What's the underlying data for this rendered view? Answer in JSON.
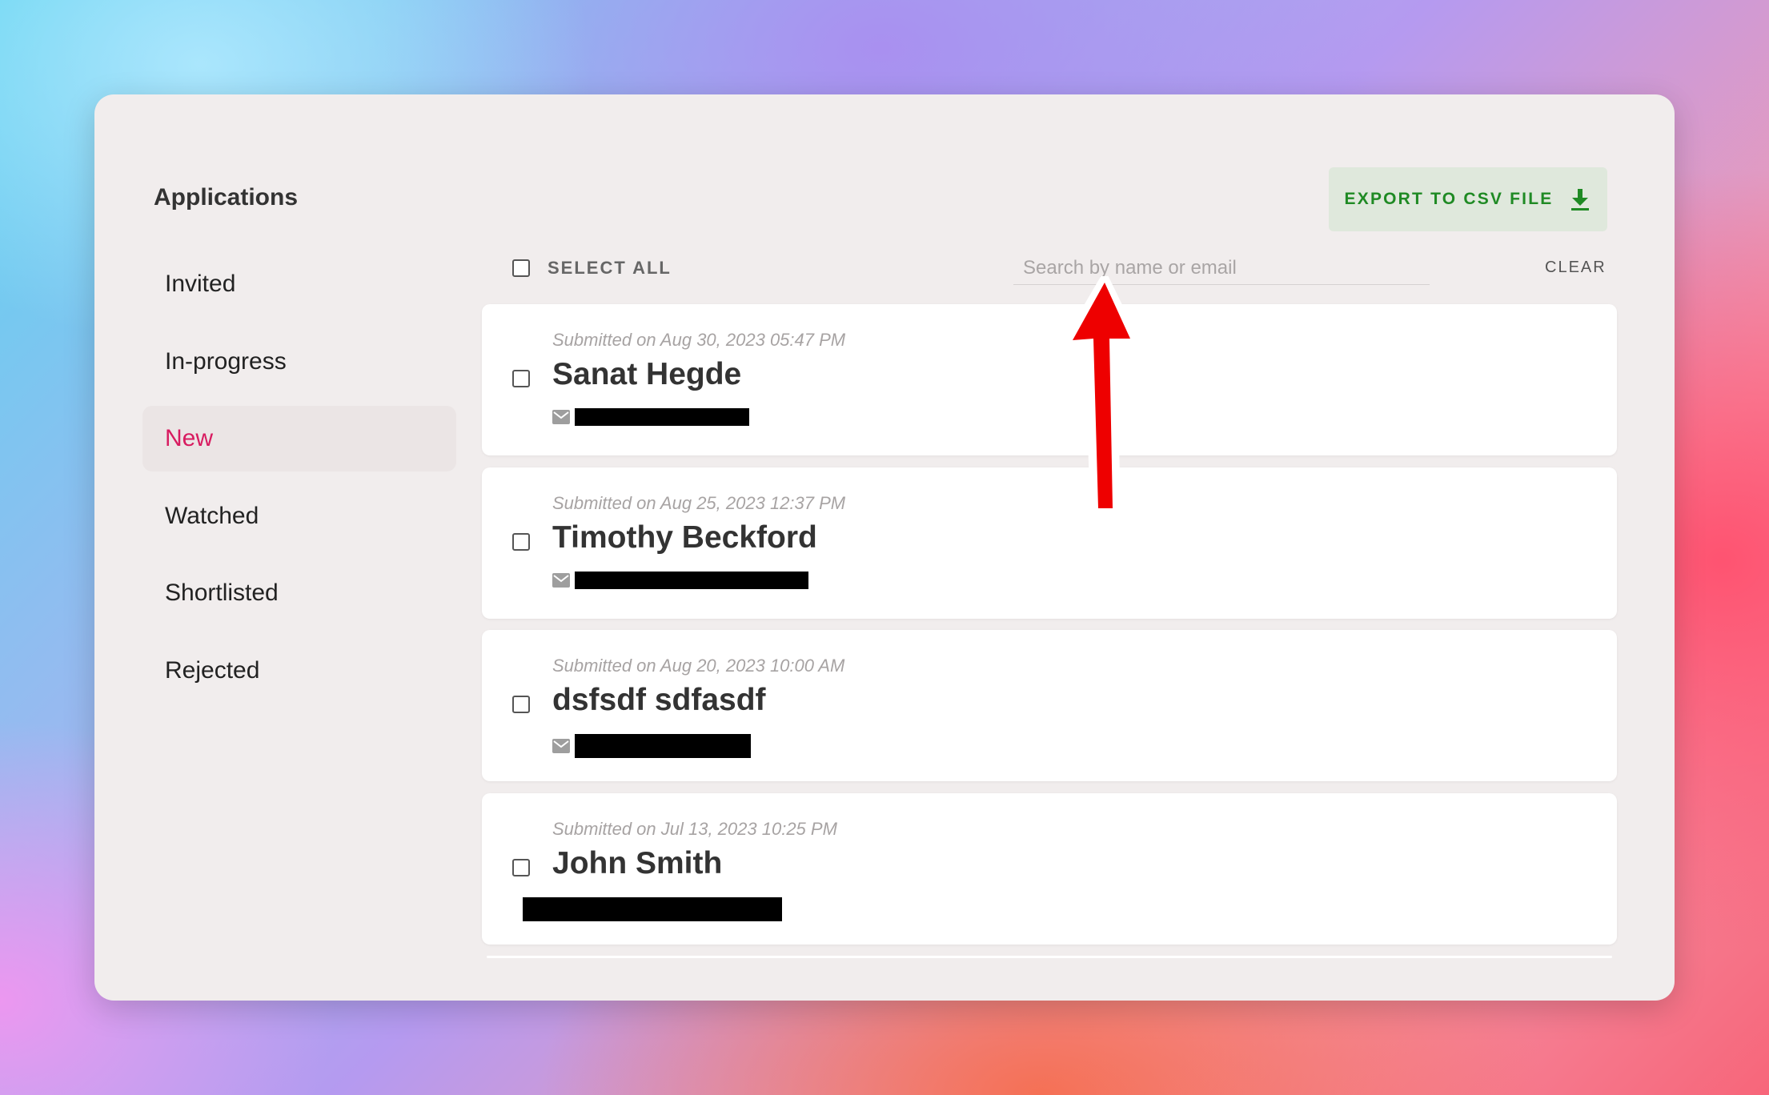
{
  "sidebar": {
    "title": "Applications",
    "items": [
      {
        "label": "Invited"
      },
      {
        "label": "In-progress"
      },
      {
        "label": "New",
        "active": true
      },
      {
        "label": "Watched"
      },
      {
        "label": "Shortlisted"
      },
      {
        "label": "Rejected"
      }
    ]
  },
  "toolbar": {
    "export_label": "EXPORT TO CSV FILE",
    "export_icon": "download-icon",
    "select_all_label": "SELECT ALL",
    "search_placeholder": "Search by name or email",
    "search_value": "",
    "clear_label": "CLEAR"
  },
  "applications": [
    {
      "submitted": "Submitted on Aug 30, 2023 05:47 PM",
      "name": "Sanat Hegde",
      "email_redacted": true
    },
    {
      "submitted": "Submitted on Aug 25, 2023 12:37 PM",
      "name": "Timothy Beckford",
      "email_redacted": true
    },
    {
      "submitted": "Submitted on Aug 20, 2023 10:00 AM",
      "name": "dsfsdf sdfasdf",
      "email_redacted": true
    },
    {
      "submitted": "Submitted on Jul 13, 2023 10:25 PM",
      "name": "John Smith",
      "email_redacted": true
    }
  ],
  "colors": {
    "active_nav": "#d81b60",
    "export_text": "#1f8a24",
    "export_bg": "#dfe8dc",
    "annotation_arrow": "#ee0000"
  }
}
